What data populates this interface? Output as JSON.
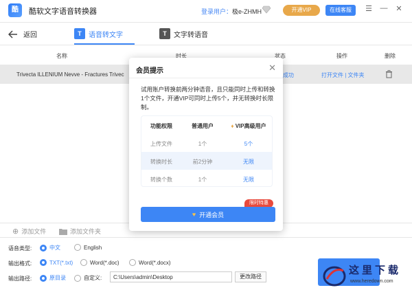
{
  "app": {
    "logo": "酷",
    "title": "酷软文字语音转换器"
  },
  "header": {
    "login_prefix": "登录用户：",
    "user": "极e-ZHMH",
    "vip_label": "开通VIP",
    "service_label": "在线客服",
    "icons": [
      "diamond-icon",
      "menu-icon",
      "minimize-icon",
      "close-icon"
    ]
  },
  "toolbar": {
    "back_label": "返回",
    "tabs": [
      {
        "label": "语音转文字",
        "active": true
      },
      {
        "label": "文字转语音",
        "active": false
      }
    ]
  },
  "table": {
    "headers": [
      "名称",
      "时长",
      "状态",
      "操作",
      "删除"
    ],
    "rows": [
      {
        "name": "Trivecta ILLENIUM Nevve - Fractures Trivec",
        "status": "成功",
        "actions": "打开文件 | 文件夹"
      }
    ]
  },
  "add_bar": {
    "add_file": "添加文件",
    "add_folder": "添加文件夹"
  },
  "options": {
    "lang_label": "语音类型:",
    "lang_options": [
      {
        "label": "中文",
        "selected": true
      },
      {
        "label": "English",
        "selected": false
      }
    ],
    "format_label": "输出格式:",
    "format_options": [
      {
        "label": "TXT(*.txt)",
        "selected": true
      },
      {
        "label": "Word(*.doc)",
        "selected": false
      },
      {
        "label": "Word(*.docx)",
        "selected": false
      }
    ],
    "path_label": "输出路径:",
    "path_options": [
      {
        "label": "原目录",
        "selected": true
      },
      {
        "label": "自定义:",
        "selected": false
      }
    ],
    "path_value": "C:\\Users\\admin\\Desktop",
    "change_path": "更改路径"
  },
  "modal": {
    "title": "会员提示",
    "desc": "试用账户转换前两分钟语音，且只能同时上传和转换1个文件，开通VIP可同时上传5个，并无转换时长限制。",
    "table_header": [
      "功能权限",
      "普通用户",
      "VIP高级用户"
    ],
    "table_rows": [
      [
        "上传文件",
        "1个",
        "5个"
      ],
      [
        "转换时长",
        "前2分钟",
        "无限"
      ],
      [
        "转换个数",
        "1个",
        "无限"
      ]
    ],
    "badge": "限时特惠",
    "button": "开通会员"
  },
  "watermark": {
    "text": "这里下载",
    "url": "www.heredown.com"
  },
  "colors": {
    "accent": "#3d86f5",
    "vip": "#e8a84a",
    "badge": "#e84a3d"
  }
}
